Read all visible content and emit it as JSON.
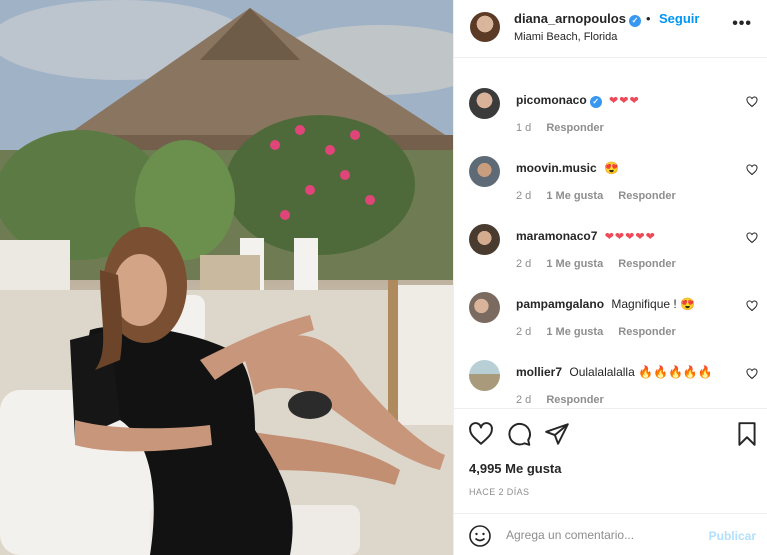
{
  "post": {
    "username": "diana_arnopoulos",
    "verified_glyph": "✓",
    "separator": "•",
    "follow_label": "Seguir",
    "location": "Miami Beach, Florida",
    "more_icon": "more-horizontal-icon",
    "more_glyph": "•••"
  },
  "comments": [
    {
      "user": "picomonaco",
      "verified": true,
      "text": "❤❤❤",
      "age": "1 d",
      "likes": "",
      "reply": "Responder",
      "avatar_color": "#3b3b3b"
    },
    {
      "user": "moovin.music",
      "verified": false,
      "text": "😍",
      "age": "2 d",
      "likes": "1 Me gusta",
      "reply": "Responder",
      "avatar_color": "#5e6b77"
    },
    {
      "user": "maramonaco7",
      "verified": false,
      "text": "❤❤❤❤❤",
      "age": "2 d",
      "likes": "1 Me gusta",
      "reply": "Responder",
      "avatar_color": "#4a3b30"
    },
    {
      "user": "pampamgalano",
      "verified": false,
      "text": "Magnifique ! 😍",
      "age": "2 d",
      "likes": "1 Me gusta",
      "reply": "Responder",
      "avatar_color": "#7a6a60"
    },
    {
      "user": "mollier7",
      "verified": false,
      "text": "Oulalalalalla 🔥🔥🔥🔥🔥",
      "age": "2 d",
      "likes": "",
      "reply": "Responder",
      "avatar_color": "#9fb3a6"
    }
  ],
  "actions": {
    "like_icon": "heart-icon",
    "comment_icon": "comment-icon",
    "share_icon": "send-icon",
    "save_icon": "bookmark-icon",
    "likes_text": "4,995 Me gusta",
    "date_text": "HACE 2 DÍAS"
  },
  "add_comment": {
    "emoji_icon": "emoji-icon",
    "placeholder": "Agrega un comentario...",
    "post_label": "Publicar"
  },
  "colors": {
    "accent": "#0095f6",
    "verified": "#3897f0",
    "heart": "#ed4956",
    "muted": "#8e8e8e",
    "post_disabled": "#b2dffc"
  }
}
